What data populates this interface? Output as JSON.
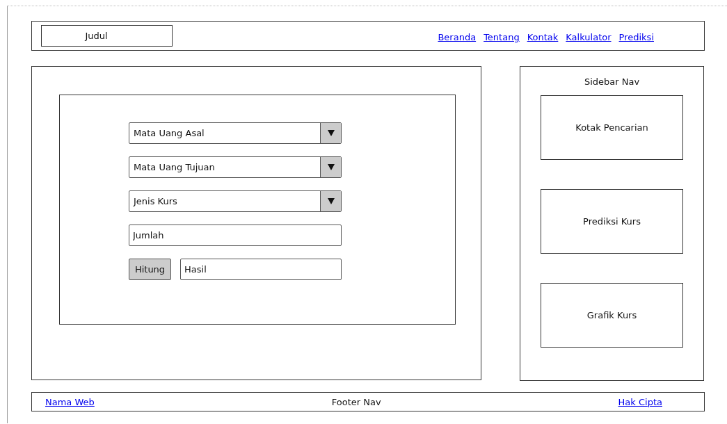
{
  "header": {
    "title": "Judul",
    "nav": [
      "Beranda",
      "Tentang",
      "Kontak",
      "Kalkulator",
      "Prediksi"
    ]
  },
  "form": {
    "fields": [
      {
        "kind": "dropdown",
        "value": "Mata Uang Asal"
      },
      {
        "kind": "dropdown",
        "value": "Mata Uang Tujuan"
      },
      {
        "kind": "dropdown",
        "value": "Jenis Kurs"
      },
      {
        "kind": "input",
        "value": "Jumlah"
      }
    ],
    "button": "Hitung",
    "result": "Hasil"
  },
  "sidebar": {
    "title": "Sidebar Nav",
    "boxes": [
      "Kotak Pencarian",
      "Prediksi Kurs",
      "Grafik Kurs"
    ]
  },
  "footer": {
    "left_link": "Nama Web",
    "center": "Footer Nav",
    "right_link": "Hak Cipta"
  }
}
